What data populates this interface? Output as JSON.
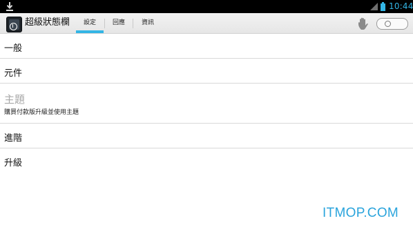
{
  "status_bar": {
    "time": "10:44"
  },
  "app": {
    "title": "超級狀態欄"
  },
  "tabs": [
    {
      "label": "設定",
      "active": true
    },
    {
      "label": "回應",
      "active": false
    },
    {
      "label": "資訊",
      "active": false
    }
  ],
  "toggle": {
    "state": "off"
  },
  "settings": {
    "items": [
      {
        "title": "一般"
      },
      {
        "title": "元件"
      },
      {
        "title": "主題",
        "subtitle": "購買付款版升級並使用主題",
        "enabled": false
      },
      {
        "title": "進階"
      },
      {
        "title": "升級"
      }
    ]
  },
  "watermark": "ITMOP.COM",
  "colors": {
    "accent": "#33b5e5",
    "status_bar": "#000000",
    "watermark": "#2aa4dc"
  }
}
